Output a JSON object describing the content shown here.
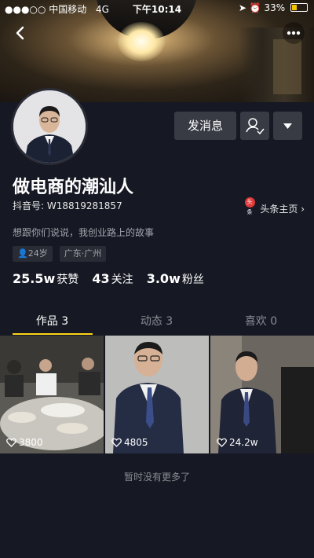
{
  "status_bar": {
    "carrier": "中国移动",
    "network": "4G",
    "time": "下午10:14",
    "battery_text": "33%",
    "battery_level": 0.33
  },
  "profile": {
    "name": "做电商的潮汕人",
    "douyin_id": "抖音号: W18819281857",
    "toutiao_link": "头条主页",
    "toutiao_logo": "头条",
    "bio": "想跟你们说说，我创业路上的故事",
    "age_tag": "24岁",
    "location_tag": "广东·广州"
  },
  "actions": {
    "message_label": "发消息"
  },
  "stats": [
    {
      "value": "25.5w",
      "label": "获赞"
    },
    {
      "value": "43",
      "label": "关注"
    },
    {
      "value": "3.0w",
      "label": "粉丝"
    }
  ],
  "tabs": [
    {
      "label": "作品 3"
    },
    {
      "label": "动态 3"
    },
    {
      "label": "喜欢 0"
    }
  ],
  "videos": [
    {
      "likes": "3800"
    },
    {
      "likes": "4805"
    },
    {
      "likes": "24.2w"
    }
  ],
  "empty_text": "暂时没有更多了",
  "colors": {
    "background": "#161823",
    "button": "#393b44",
    "accent": "#fdd317"
  }
}
